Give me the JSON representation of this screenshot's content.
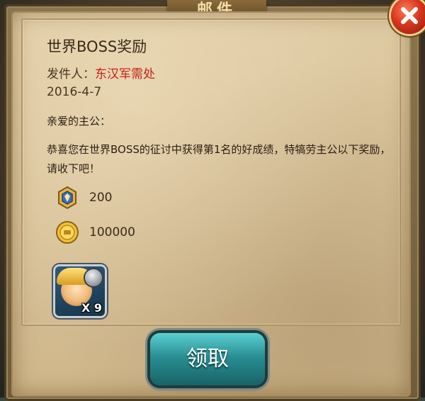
{
  "dialog": {
    "header_label": "邮件",
    "close_icon": "close-icon"
  },
  "mail": {
    "title": "世界BOSS奖励",
    "sender_label": "发件人：",
    "sender_name": "东汉军需处",
    "date": "2016-4-7",
    "greeting": "亲爱的主公：",
    "body": "恭喜您在世界BOSS的征讨中获得第1名的好成绩，特犒劳主公以下奖励，请收下吧！"
  },
  "rewards": [
    {
      "icon": "medal-token-icon",
      "amount": "200"
    },
    {
      "icon": "gold-coin-icon",
      "amount": "100000"
    }
  ],
  "item": {
    "icon": "hero-portrait-icon",
    "count": "X 9"
  },
  "claim_button": {
    "label": "领取"
  },
  "colors": {
    "sender_name": "#c2221a",
    "claim_button": "#2a8f92",
    "close_button": "#d7361c"
  }
}
